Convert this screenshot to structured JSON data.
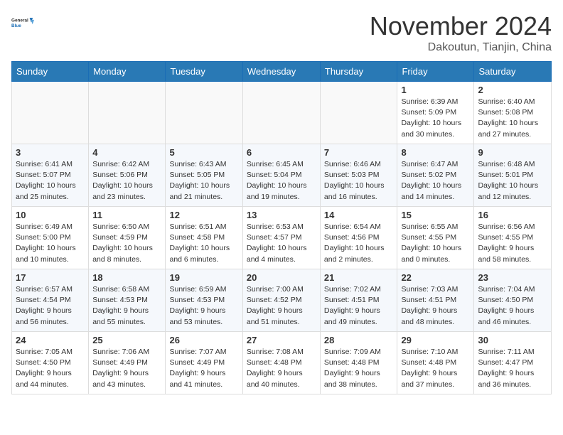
{
  "header": {
    "logo_line1": "General",
    "logo_line2": "Blue",
    "month": "November 2024",
    "location": "Dakoutun, Tianjin, China"
  },
  "days_of_week": [
    "Sunday",
    "Monday",
    "Tuesday",
    "Wednesday",
    "Thursday",
    "Friday",
    "Saturday"
  ],
  "weeks": [
    [
      {
        "day": "",
        "info": ""
      },
      {
        "day": "",
        "info": ""
      },
      {
        "day": "",
        "info": ""
      },
      {
        "day": "",
        "info": ""
      },
      {
        "day": "",
        "info": ""
      },
      {
        "day": "1",
        "info": "Sunrise: 6:39 AM\nSunset: 5:09 PM\nDaylight: 10 hours\nand 30 minutes."
      },
      {
        "day": "2",
        "info": "Sunrise: 6:40 AM\nSunset: 5:08 PM\nDaylight: 10 hours\nand 27 minutes."
      }
    ],
    [
      {
        "day": "3",
        "info": "Sunrise: 6:41 AM\nSunset: 5:07 PM\nDaylight: 10 hours\nand 25 minutes."
      },
      {
        "day": "4",
        "info": "Sunrise: 6:42 AM\nSunset: 5:06 PM\nDaylight: 10 hours\nand 23 minutes."
      },
      {
        "day": "5",
        "info": "Sunrise: 6:43 AM\nSunset: 5:05 PM\nDaylight: 10 hours\nand 21 minutes."
      },
      {
        "day": "6",
        "info": "Sunrise: 6:45 AM\nSunset: 5:04 PM\nDaylight: 10 hours\nand 19 minutes."
      },
      {
        "day": "7",
        "info": "Sunrise: 6:46 AM\nSunset: 5:03 PM\nDaylight: 10 hours\nand 16 minutes."
      },
      {
        "day": "8",
        "info": "Sunrise: 6:47 AM\nSunset: 5:02 PM\nDaylight: 10 hours\nand 14 minutes."
      },
      {
        "day": "9",
        "info": "Sunrise: 6:48 AM\nSunset: 5:01 PM\nDaylight: 10 hours\nand 12 minutes."
      }
    ],
    [
      {
        "day": "10",
        "info": "Sunrise: 6:49 AM\nSunset: 5:00 PM\nDaylight: 10 hours\nand 10 minutes."
      },
      {
        "day": "11",
        "info": "Sunrise: 6:50 AM\nSunset: 4:59 PM\nDaylight: 10 hours\nand 8 minutes."
      },
      {
        "day": "12",
        "info": "Sunrise: 6:51 AM\nSunset: 4:58 PM\nDaylight: 10 hours\nand 6 minutes."
      },
      {
        "day": "13",
        "info": "Sunrise: 6:53 AM\nSunset: 4:57 PM\nDaylight: 10 hours\nand 4 minutes."
      },
      {
        "day": "14",
        "info": "Sunrise: 6:54 AM\nSunset: 4:56 PM\nDaylight: 10 hours\nand 2 minutes."
      },
      {
        "day": "15",
        "info": "Sunrise: 6:55 AM\nSunset: 4:55 PM\nDaylight: 10 hours\nand 0 minutes."
      },
      {
        "day": "16",
        "info": "Sunrise: 6:56 AM\nSunset: 4:55 PM\nDaylight: 9 hours\nand 58 minutes."
      }
    ],
    [
      {
        "day": "17",
        "info": "Sunrise: 6:57 AM\nSunset: 4:54 PM\nDaylight: 9 hours\nand 56 minutes."
      },
      {
        "day": "18",
        "info": "Sunrise: 6:58 AM\nSunset: 4:53 PM\nDaylight: 9 hours\nand 55 minutes."
      },
      {
        "day": "19",
        "info": "Sunrise: 6:59 AM\nSunset: 4:53 PM\nDaylight: 9 hours\nand 53 minutes."
      },
      {
        "day": "20",
        "info": "Sunrise: 7:00 AM\nSunset: 4:52 PM\nDaylight: 9 hours\nand 51 minutes."
      },
      {
        "day": "21",
        "info": "Sunrise: 7:02 AM\nSunset: 4:51 PM\nDaylight: 9 hours\nand 49 minutes."
      },
      {
        "day": "22",
        "info": "Sunrise: 7:03 AM\nSunset: 4:51 PM\nDaylight: 9 hours\nand 48 minutes."
      },
      {
        "day": "23",
        "info": "Sunrise: 7:04 AM\nSunset: 4:50 PM\nDaylight: 9 hours\nand 46 minutes."
      }
    ],
    [
      {
        "day": "24",
        "info": "Sunrise: 7:05 AM\nSunset: 4:50 PM\nDaylight: 9 hours\nand 44 minutes."
      },
      {
        "day": "25",
        "info": "Sunrise: 7:06 AM\nSunset: 4:49 PM\nDaylight: 9 hours\nand 43 minutes."
      },
      {
        "day": "26",
        "info": "Sunrise: 7:07 AM\nSunset: 4:49 PM\nDaylight: 9 hours\nand 41 minutes."
      },
      {
        "day": "27",
        "info": "Sunrise: 7:08 AM\nSunset: 4:48 PM\nDaylight: 9 hours\nand 40 minutes."
      },
      {
        "day": "28",
        "info": "Sunrise: 7:09 AM\nSunset: 4:48 PM\nDaylight: 9 hours\nand 38 minutes."
      },
      {
        "day": "29",
        "info": "Sunrise: 7:10 AM\nSunset: 4:48 PM\nDaylight: 9 hours\nand 37 minutes."
      },
      {
        "day": "30",
        "info": "Sunrise: 7:11 AM\nSunset: 4:47 PM\nDaylight: 9 hours\nand 36 minutes."
      }
    ]
  ]
}
